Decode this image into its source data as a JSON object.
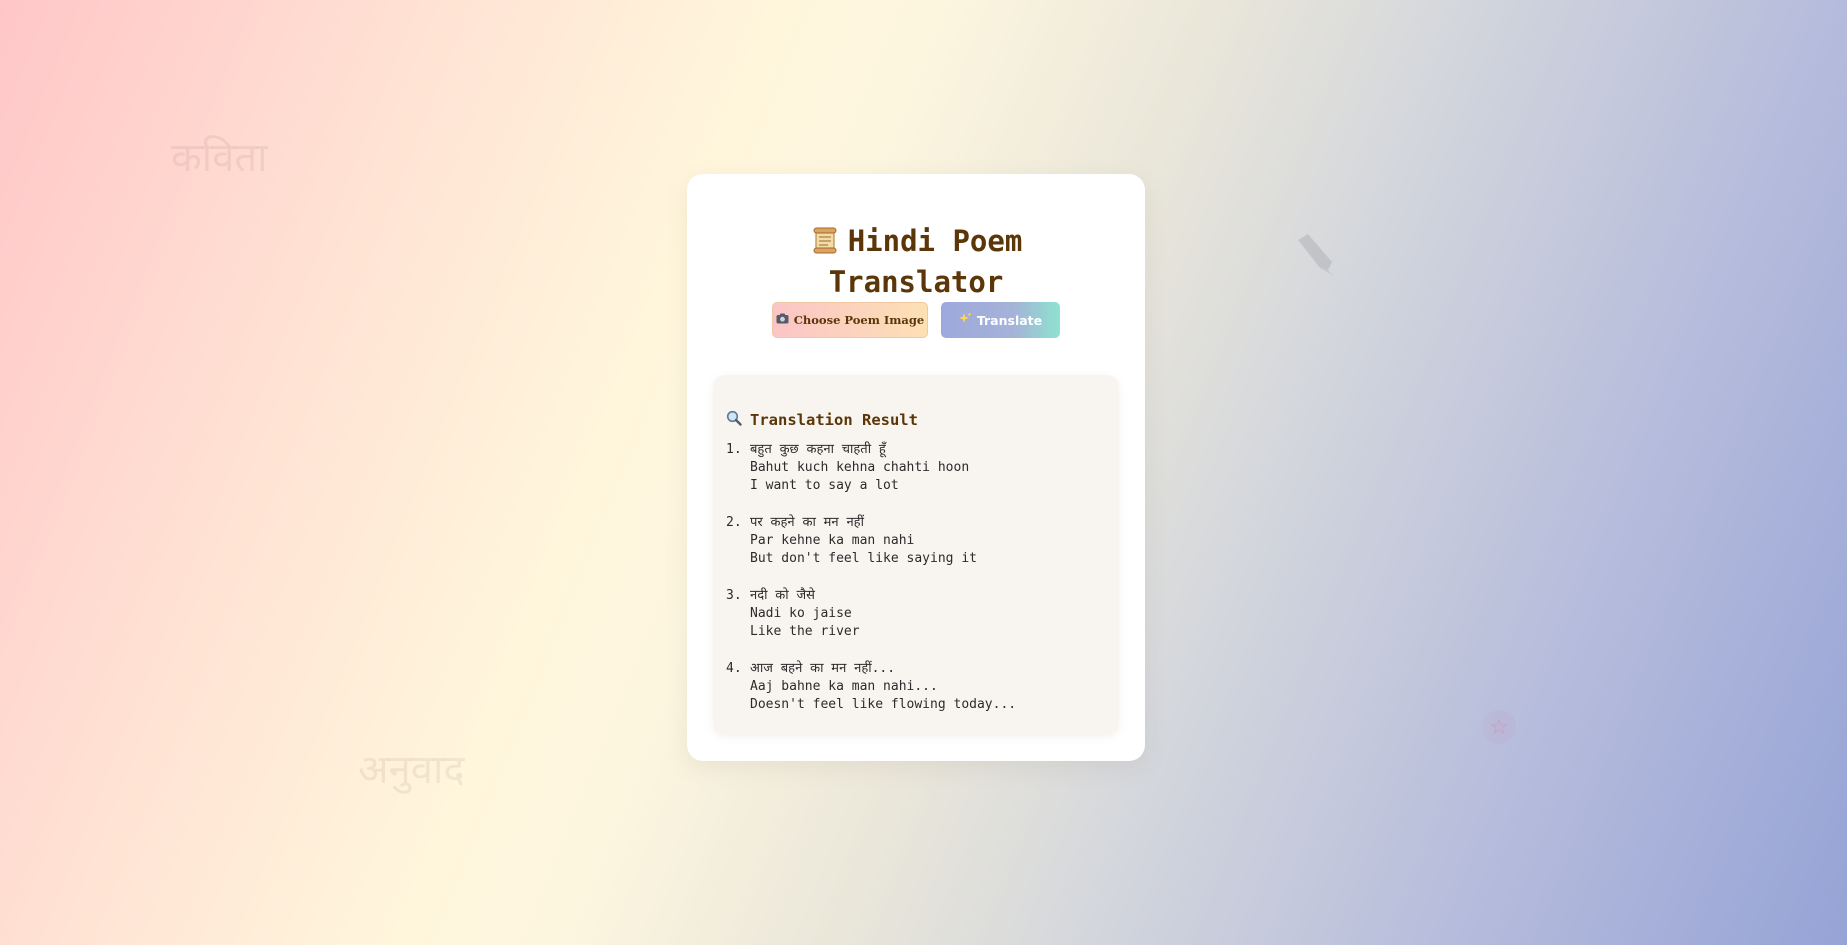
{
  "background": {
    "words": [
      "कविता",
      "अनुवाद"
    ]
  },
  "app": {
    "title": "Hindi Poem Translator",
    "title_icon": "scroll-icon"
  },
  "buttons": {
    "choose_label": "Choose Poem Image",
    "choose_icon": "camera-icon",
    "translate_label": "Translate",
    "translate_icon": "sparkles-icon"
  },
  "result": {
    "heading": "Translation Result",
    "heading_icon": "magnifier-icon",
    "lines": [
      {
        "number": "1.",
        "hindi": "बहुत कुछ कहना चाहती हूँ",
        "transliteration": "Bahut kuch kehna chahti hoon",
        "english": "I want to say a lot"
      },
      {
        "number": "2.",
        "hindi": "पर कहने का मन नहीं",
        "transliteration": "Par kehne ka man nahi",
        "english": "But don't feel like saying it"
      },
      {
        "number": "3.",
        "hindi": "नदी को जैसे",
        "transliteration": "Nadi ko jaise",
        "english": "Like the river"
      },
      {
        "number": "4.",
        "hindi": "आज बहने का मन नहीं...",
        "transliteration": "Aaj bahne ka man nahi...",
        "english": "Doesn't feel like flowing today..."
      }
    ]
  },
  "colors": {
    "title_text": "#5b3608",
    "card_bg": "#ffffff",
    "result_bg": "#f8f5f1"
  }
}
